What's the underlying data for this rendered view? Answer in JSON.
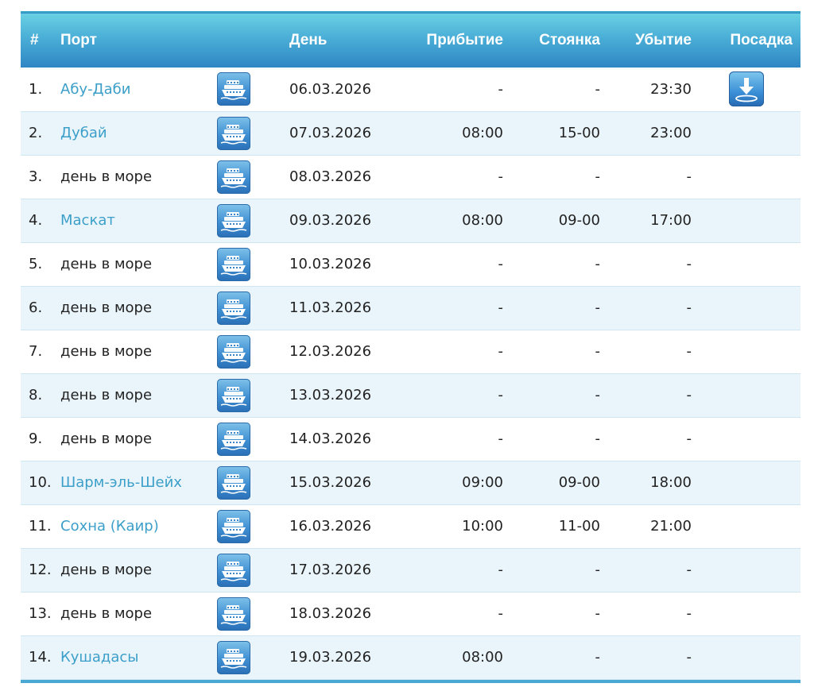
{
  "table": {
    "headers": {
      "num": "#",
      "port": "Порт",
      "day": "День",
      "arrival": "Прибытие",
      "stay": "Стоянка",
      "departure": "Убытие",
      "boarding": "Посадка"
    },
    "rows": [
      {
        "num": "1.",
        "port": "Абу-Даби",
        "link": true,
        "date": "06.03.2026",
        "arrival": "-",
        "stay": "-",
        "departure": "23:30",
        "boarding": true
      },
      {
        "num": "2.",
        "port": "Дубай",
        "link": true,
        "date": "07.03.2026",
        "arrival": "08:00",
        "stay": "15-00",
        "departure": "23:00",
        "boarding": false
      },
      {
        "num": "3.",
        "port": "день в море",
        "link": false,
        "date": "08.03.2026",
        "arrival": "-",
        "stay": "-",
        "departure": "-",
        "boarding": false
      },
      {
        "num": "4.",
        "port": "Маскат",
        "link": true,
        "date": "09.03.2026",
        "arrival": "08:00",
        "stay": "09-00",
        "departure": "17:00",
        "boarding": false
      },
      {
        "num": "5.",
        "port": "день в море",
        "link": false,
        "date": "10.03.2026",
        "arrival": "-",
        "stay": "-",
        "departure": "-",
        "boarding": false
      },
      {
        "num": "6.",
        "port": "день в море",
        "link": false,
        "date": "11.03.2026",
        "arrival": "-",
        "stay": "-",
        "departure": "-",
        "boarding": false
      },
      {
        "num": "7.",
        "port": "день в море",
        "link": false,
        "date": "12.03.2026",
        "arrival": "-",
        "stay": "-",
        "departure": "-",
        "boarding": false
      },
      {
        "num": "8.",
        "port": "день в море",
        "link": false,
        "date": "13.03.2026",
        "arrival": "-",
        "stay": "-",
        "departure": "-",
        "boarding": false
      },
      {
        "num": "9.",
        "port": "день в море",
        "link": false,
        "date": "14.03.2026",
        "arrival": "-",
        "stay": "-",
        "departure": "-",
        "boarding": false
      },
      {
        "num": "10.",
        "port": "Шарм-эль-Шейх",
        "link": true,
        "date": "15.03.2026",
        "arrival": "09:00",
        "stay": "09-00",
        "departure": "18:00",
        "boarding": false
      },
      {
        "num": "11.",
        "port": "Сохна (Каир)",
        "link": true,
        "date": "16.03.2026",
        "arrival": "10:00",
        "stay": "11-00",
        "departure": "21:00",
        "boarding": false
      },
      {
        "num": "12.",
        "port": "день в море",
        "link": false,
        "date": "17.03.2026",
        "arrival": "-",
        "stay": "-",
        "departure": "-",
        "boarding": false
      },
      {
        "num": "13.",
        "port": "день в море",
        "link": false,
        "date": "18.03.2026",
        "arrival": "-",
        "stay": "-",
        "departure": "-",
        "boarding": false
      },
      {
        "num": "14.",
        "port": "Кушадасы",
        "link": true,
        "date": "19.03.2026",
        "arrival": "08:00",
        "stay": "-",
        "departure": "-",
        "boarding": false
      }
    ]
  },
  "icons": {
    "ship": "ship-icon",
    "boarding": "boarding-download-icon"
  },
  "colors": {
    "header_top": "#6ad0e2",
    "header_bottom": "#2f86c4",
    "link": "#3c9fc9",
    "row_alt": "#eaf5fb"
  }
}
